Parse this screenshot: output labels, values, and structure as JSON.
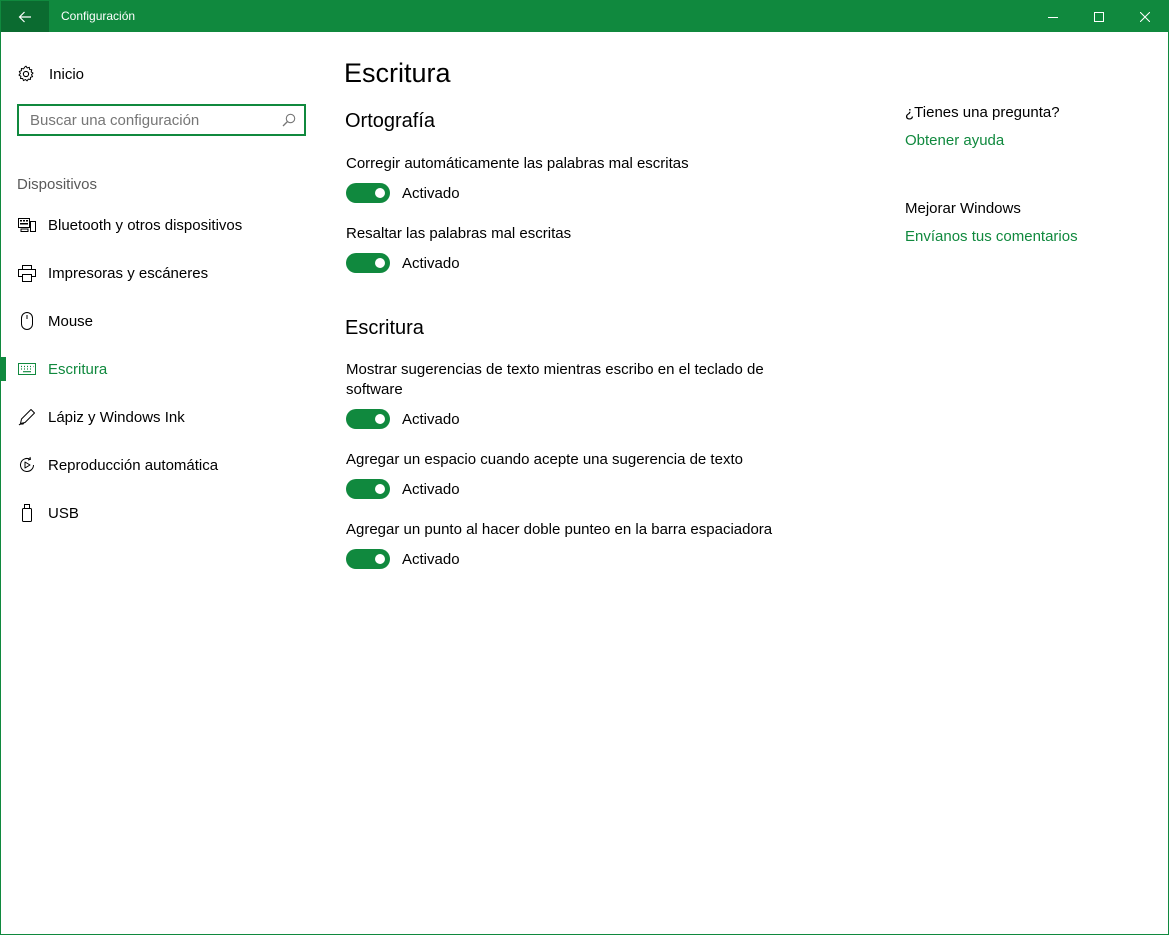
{
  "window": {
    "title": "Configuración",
    "accent": "#10893e",
    "back_accent": "#0b6b30"
  },
  "sidebar": {
    "home_label": "Inicio",
    "search_placeholder": "Buscar una configuración",
    "section_label": "Dispositivos",
    "items": [
      {
        "label": "Bluetooth y otros dispositivos",
        "icon": "bluetooth-devices-icon"
      },
      {
        "label": "Impresoras y escáneres",
        "icon": "printer-icon"
      },
      {
        "label": "Mouse",
        "icon": "mouse-icon"
      },
      {
        "label": "Escritura",
        "icon": "keyboard-icon",
        "active": true
      },
      {
        "label": "Lápiz y Windows Ink",
        "icon": "pen-icon"
      },
      {
        "label": "Reproducción automática",
        "icon": "autoplay-icon"
      },
      {
        "label": "USB",
        "icon": "usb-icon"
      }
    ]
  },
  "main": {
    "title": "Escritura",
    "groups": [
      {
        "title": "Ortografía",
        "settings": [
          {
            "label": "Corregir automáticamente las palabras mal escritas",
            "state": "Activado",
            "on": true
          },
          {
            "label": "Resaltar las palabras mal escritas",
            "state": "Activado",
            "on": true
          }
        ]
      },
      {
        "title": "Escritura",
        "settings": [
          {
            "label": "Mostrar sugerencias de texto mientras escribo en el teclado de software",
            "state": "Activado",
            "on": true
          },
          {
            "label": "Agregar un espacio cuando acepte una sugerencia de texto",
            "state": "Activado",
            "on": true
          },
          {
            "label": "Agregar un punto al hacer doble punteo en la barra espaciadora",
            "state": "Activado",
            "on": true
          }
        ]
      }
    ]
  },
  "right_panel": {
    "question_heading": "¿Tienes una pregunta?",
    "help_link": "Obtener ayuda",
    "improve_heading": "Mejorar Windows",
    "feedback_link": "Envíanos tus comentarios"
  }
}
